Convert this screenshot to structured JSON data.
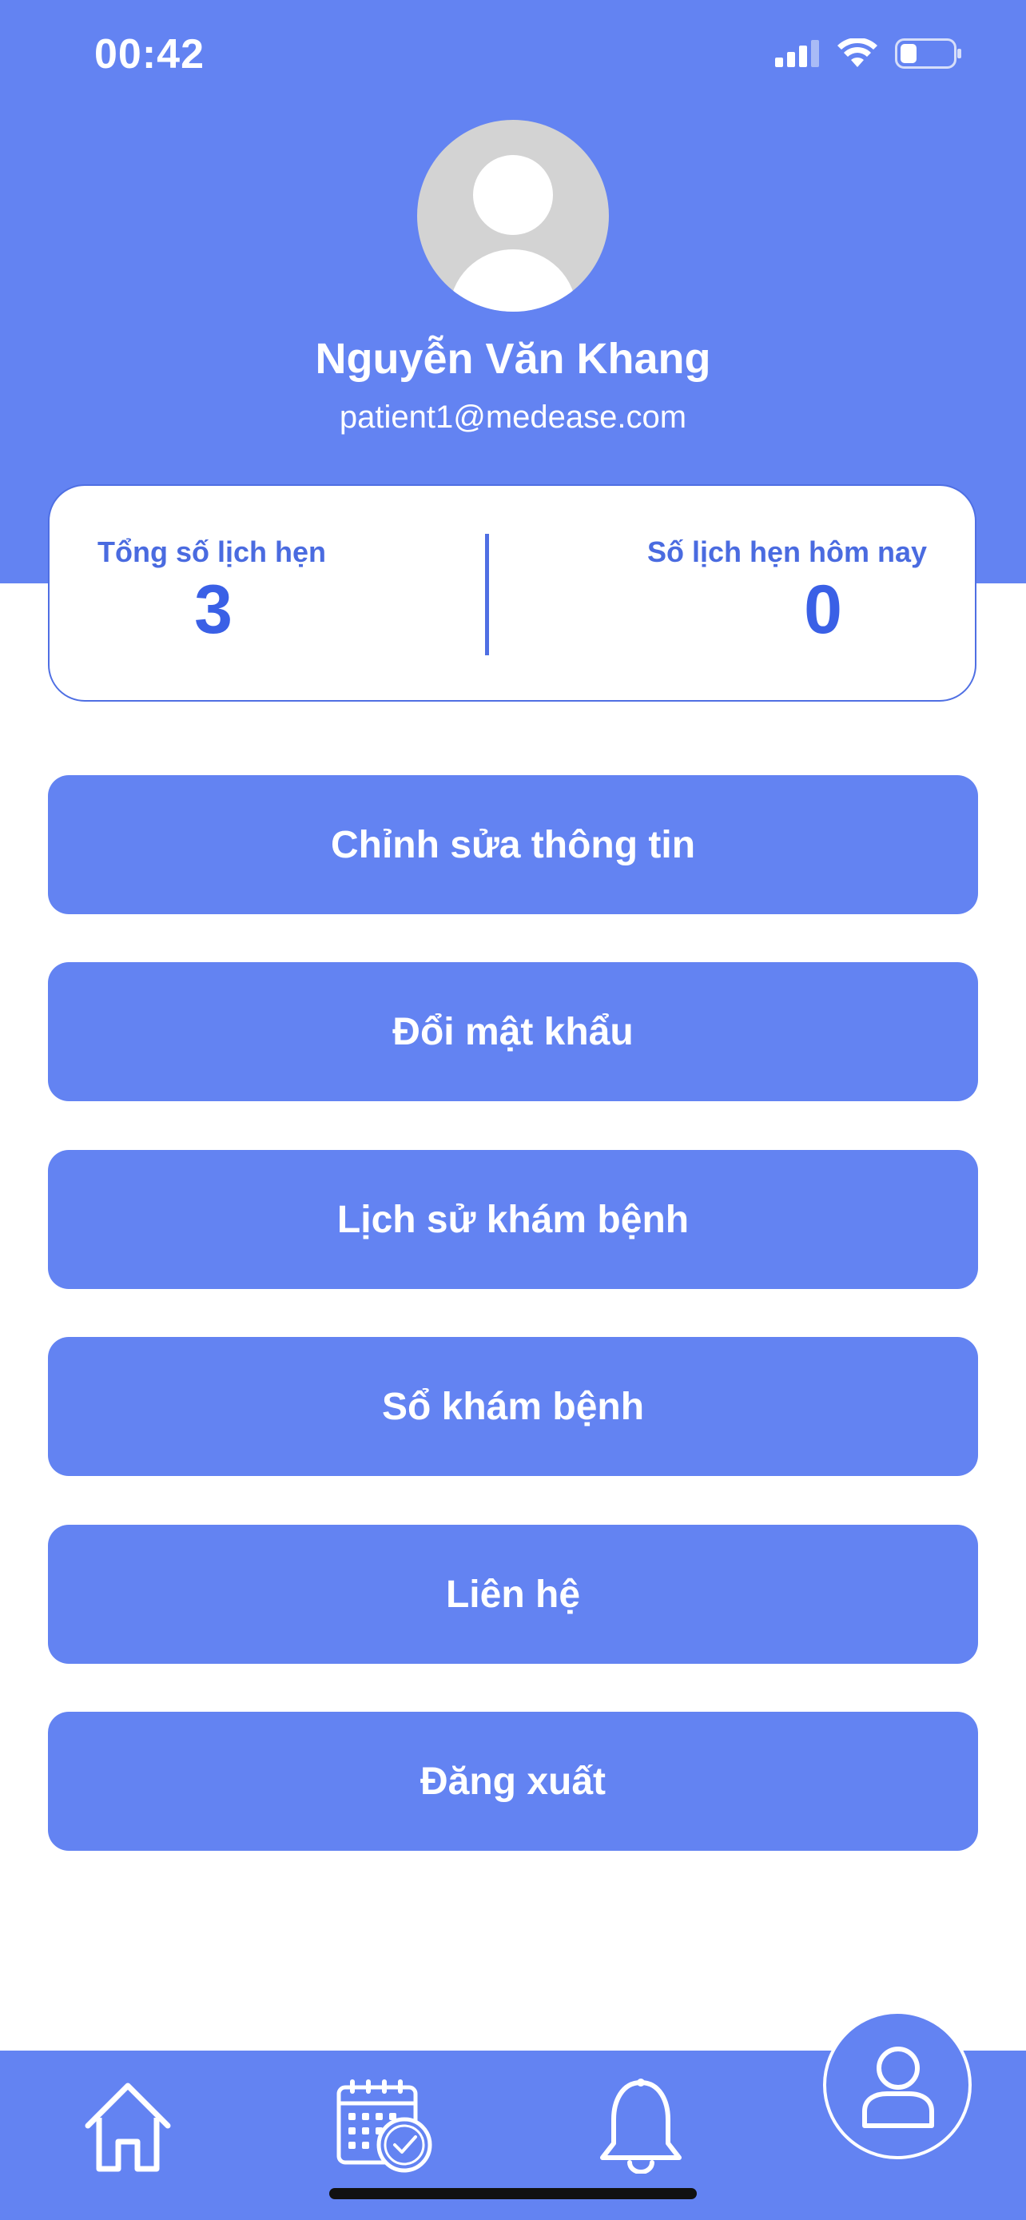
{
  "status_bar": {
    "time": "00:42",
    "icons": [
      "signal-icon",
      "wifi-icon",
      "battery-icon"
    ]
  },
  "profile": {
    "name": "Nguyễn Văn Khang",
    "email": "patient1@medease.com"
  },
  "stats": {
    "total_label": "Tổng số lịch hẹn",
    "total_value": "3",
    "today_label": "Số lịch hẹn hôm nay",
    "today_value": "0"
  },
  "menu": {
    "edit_info": "Chỉnh sửa thông tin",
    "change_password": "Đổi mật khẩu",
    "medical_history": "Lịch sử khám bệnh",
    "medical_record": "Sổ khám bệnh",
    "contact": "Liên hệ",
    "logout": "Đăng xuất"
  },
  "bottom_nav": {
    "items": [
      "home-icon",
      "calendar-clock-icon",
      "bell-icon",
      "profile-icon"
    ],
    "active": "profile-icon"
  },
  "colors": {
    "primary": "#6383F2",
    "accent_text": "#3a60e6",
    "avatar_bg": "#D3D3D3"
  }
}
